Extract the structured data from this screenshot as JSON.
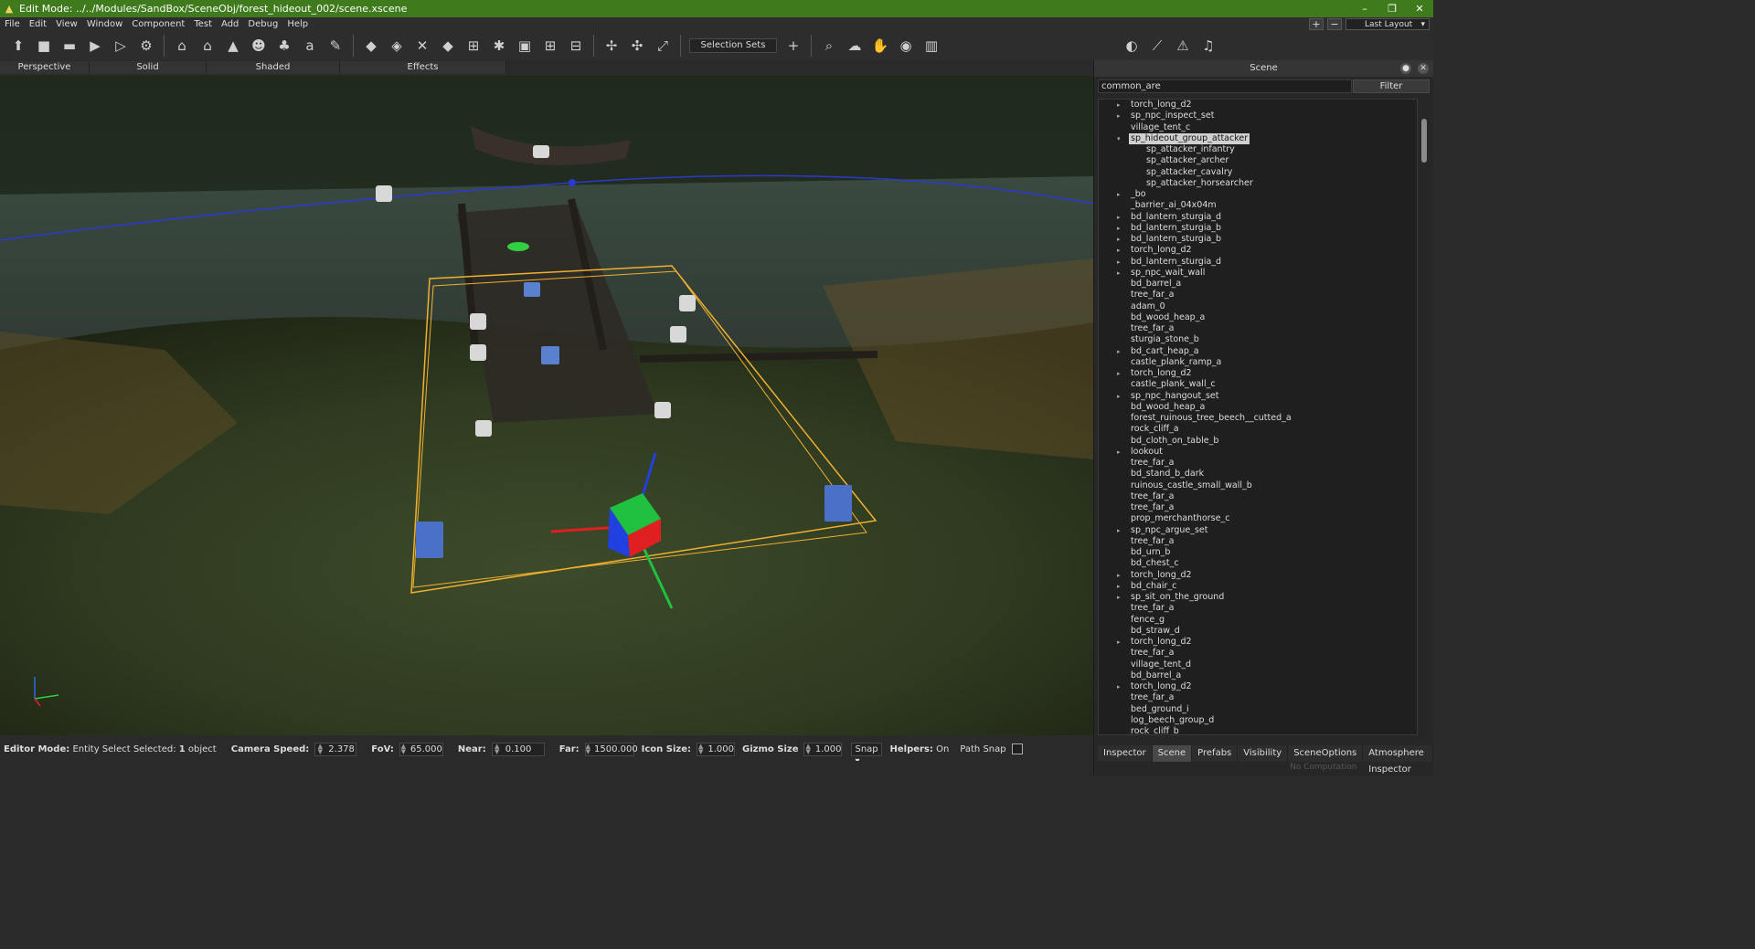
{
  "window": {
    "title": "Edit Mode: ../../Modules/SandBox/SceneObj/forest_hideout_002/scene.xscene",
    "minimize": "–",
    "restore": "❐",
    "close": "✕"
  },
  "menu": [
    "File",
    "Edit",
    "View",
    "Window",
    "Component",
    "Test",
    "Add",
    "Debug",
    "Help"
  ],
  "layout": {
    "plus": "+",
    "minus": "−",
    "label": "Last Layout",
    "arrow": "▾"
  },
  "toolbar": {
    "selection_sets": "Selection Sets",
    "add": "+"
  },
  "view_tabs": [
    "Perspective",
    "Solid",
    "Shaded",
    "Effects"
  ],
  "status": {
    "editor_mode_label": "Editor Mode:",
    "editor_mode_text": "Entity Select Selected:",
    "selected_count": "1",
    "selected_unit": "object",
    "camera_speed_label": "Camera Speed:",
    "camera_speed": "2.378",
    "fov_label": "FoV:",
    "fov": "65.000",
    "near_label": "Near:",
    "near": "0.100",
    "far_label": "Far:",
    "far": "1500.000",
    "icon_size_label": "Icon Size:",
    "icon_size": "1.000",
    "gizmo_size_label": "Gizmo Size",
    "gizmo_size": "1.000",
    "snap": "Snap",
    "helpers_label": "Helpers:",
    "helpers": "On",
    "path_snap": "Path Snap"
  },
  "scene_panel": {
    "title": "Scene",
    "search_value": "common_are",
    "filter_label": "Filter",
    "tabs": [
      "Inspector",
      "Scene",
      "Prefabs",
      "Visibility",
      "SceneOptions",
      "Atmosphere Inspector"
    ],
    "active_tab": "Scene",
    "footer": "No Computation",
    "tree": [
      {
        "name": "torch_long_d2",
        "arrow": "▸"
      },
      {
        "name": "sp_npc_inspect_set",
        "arrow": "▸"
      },
      {
        "name": "village_tent_c",
        "arrow": ""
      },
      {
        "name": "sp_hideout_group_attacker",
        "arrow": "▾",
        "selected": true
      },
      {
        "name": "sp_attacker_infantry",
        "arrow": "",
        "child": true
      },
      {
        "name": "sp_attacker_archer",
        "arrow": "",
        "child": true
      },
      {
        "name": "sp_attacker_cavalry",
        "arrow": "",
        "child": true
      },
      {
        "name": "sp_attacker_horsearcher",
        "arrow": "",
        "child": true
      },
      {
        "name": "_bo",
        "arrow": "▸"
      },
      {
        "name": "_barrier_ai_04x04m",
        "arrow": ""
      },
      {
        "name": "bd_lantern_sturgia_d",
        "arrow": "▸"
      },
      {
        "name": "bd_lantern_sturgia_b",
        "arrow": "▸"
      },
      {
        "name": "bd_lantern_sturgia_b",
        "arrow": "▸"
      },
      {
        "name": "torch_long_d2",
        "arrow": "▸"
      },
      {
        "name": "bd_lantern_sturgia_d",
        "arrow": "▸"
      },
      {
        "name": "sp_npc_wait_wall",
        "arrow": "▸"
      },
      {
        "name": "bd_barrel_a",
        "arrow": ""
      },
      {
        "name": "tree_far_a",
        "arrow": ""
      },
      {
        "name": "adam_0",
        "arrow": ""
      },
      {
        "name": "bd_wood_heap_a",
        "arrow": ""
      },
      {
        "name": "tree_far_a",
        "arrow": ""
      },
      {
        "name": "sturgia_stone_b",
        "arrow": ""
      },
      {
        "name": "bd_cart_heap_a",
        "arrow": "▸"
      },
      {
        "name": "castle_plank_ramp_a",
        "arrow": ""
      },
      {
        "name": "torch_long_d2",
        "arrow": "▸"
      },
      {
        "name": "castle_plank_wall_c",
        "arrow": ""
      },
      {
        "name": "sp_npc_hangout_set",
        "arrow": "▸"
      },
      {
        "name": "bd_wood_heap_a",
        "arrow": ""
      },
      {
        "name": "forest_ruinous_tree_beech__cutted_a",
        "arrow": ""
      },
      {
        "name": "rock_cliff_a",
        "arrow": ""
      },
      {
        "name": "bd_cloth_on_table_b",
        "arrow": ""
      },
      {
        "name": "lookout",
        "arrow": "▸"
      },
      {
        "name": "tree_far_a",
        "arrow": ""
      },
      {
        "name": "bd_stand_b_dark",
        "arrow": ""
      },
      {
        "name": "ruinous_castle_small_wall_b",
        "arrow": ""
      },
      {
        "name": "tree_far_a",
        "arrow": ""
      },
      {
        "name": "tree_far_a",
        "arrow": ""
      },
      {
        "name": "prop_merchanthorse_c",
        "arrow": ""
      },
      {
        "name": "sp_npc_argue_set",
        "arrow": "▸"
      },
      {
        "name": "tree_far_a",
        "arrow": ""
      },
      {
        "name": "bd_urn_b",
        "arrow": ""
      },
      {
        "name": "bd_chest_c",
        "arrow": ""
      },
      {
        "name": "torch_long_d2",
        "arrow": "▸"
      },
      {
        "name": "bd_chair_c",
        "arrow": "▸"
      },
      {
        "name": "sp_sit_on_the_ground",
        "arrow": "▸"
      },
      {
        "name": "tree_far_a",
        "arrow": ""
      },
      {
        "name": "fence_g",
        "arrow": ""
      },
      {
        "name": "bd_straw_d",
        "arrow": ""
      },
      {
        "name": "torch_long_d2",
        "arrow": "▸"
      },
      {
        "name": "tree_far_a",
        "arrow": ""
      },
      {
        "name": "village_tent_d",
        "arrow": ""
      },
      {
        "name": "bd_barrel_a",
        "arrow": ""
      },
      {
        "name": "torch_long_d2",
        "arrow": "▸"
      },
      {
        "name": "tree_far_a",
        "arrow": ""
      },
      {
        "name": "bed_ground_i",
        "arrow": ""
      },
      {
        "name": "log_beech_group_d",
        "arrow": ""
      },
      {
        "name": "rock_cliff_b",
        "arrow": ""
      }
    ]
  },
  "colors": {
    "titlebar": "#3f7a1c",
    "selection_box": "#f0b030",
    "gizmo_x": "#e02020",
    "gizmo_y": "#20c040",
    "gizmo_z": "#2040e0",
    "water_line": "#2a3ad0"
  },
  "icons": {
    "app": "app-icon",
    "close_panel": "close-icon",
    "pin_panel": "pin-icon"
  }
}
